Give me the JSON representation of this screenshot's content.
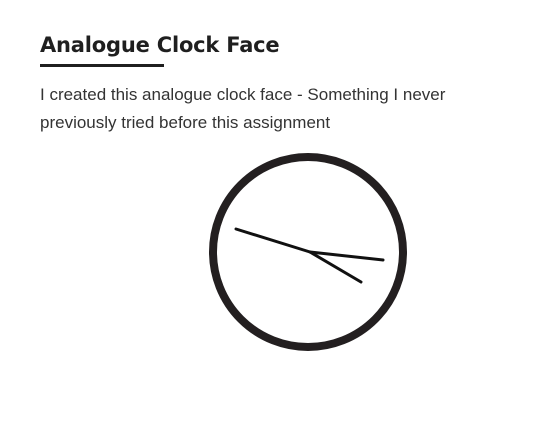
{
  "article": {
    "title": "Analogue Clock Face",
    "description": "I created this analogue clock face - Something I never previously tried before this assignment"
  },
  "clock": {
    "face_color": "#ffffff",
    "rim_color": "#231f20",
    "hand_color": "#111111"
  }
}
